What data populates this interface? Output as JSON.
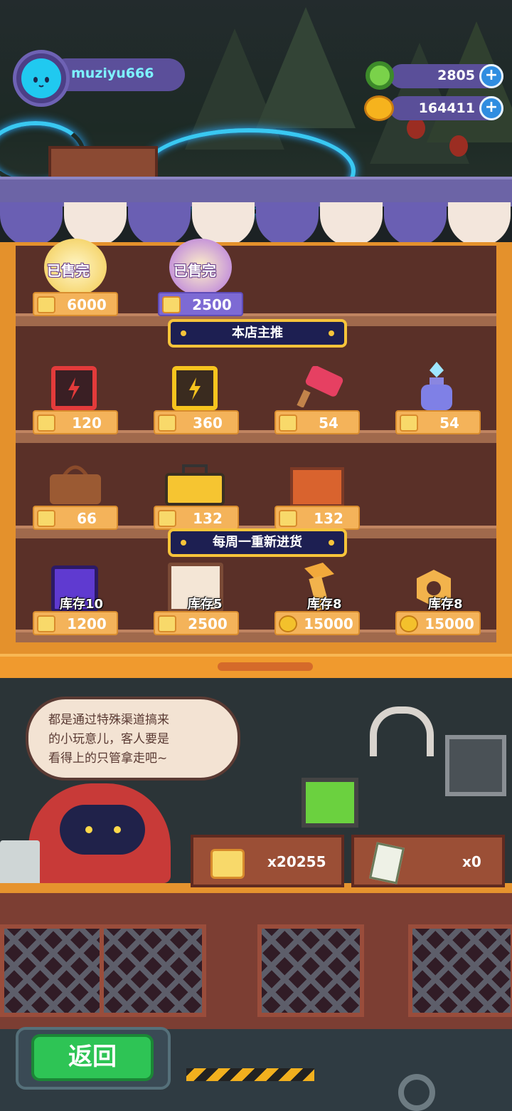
{
  "player": {
    "username": "muziyu666"
  },
  "currency": {
    "gems": "2805",
    "coins": "164411",
    "add_symbol": "+"
  },
  "shop": {
    "sold_out_label": "已售完",
    "featured_banner": "本店主推",
    "weekly_banner": "每周一重新进货",
    "top_row": [
      {
        "name": "cookie-bowl",
        "price": "6000",
        "color": "#f4b35a"
      },
      {
        "name": "grape-bowl",
        "price": "2500",
        "color": "#7d6ad4"
      }
    ],
    "featured_row1": [
      {
        "name": "red-battery",
        "price": "120"
      },
      {
        "name": "yellow-battery",
        "price": "360"
      },
      {
        "name": "paint-hammer",
        "price": "54"
      },
      {
        "name": "blue-potion",
        "price": "54"
      }
    ],
    "featured_row2": [
      {
        "name": "handbag",
        "price": "66"
      },
      {
        "name": "toolbox",
        "price": "132"
      },
      {
        "name": "orange-crate",
        "price": "132"
      }
    ],
    "weekly_row": [
      {
        "name": "purple-card",
        "stock": "库存10",
        "price": "1200",
        "currency": "ticket"
      },
      {
        "name": "photo-card",
        "stock": "库存5",
        "price": "2500",
        "currency": "ticket"
      },
      {
        "name": "golden-bolt",
        "stock": "库存8",
        "price": "15000",
        "currency": "coin"
      },
      {
        "name": "golden-nut",
        "stock": "库存8",
        "price": "15000",
        "currency": "coin"
      }
    ]
  },
  "shopkeeper": {
    "dialogue_line1": "都是通过特殊渠道搞来",
    "dialogue_line2": "的小玩意儿，客人要是",
    "dialogue_line3": "看得上的只管拿走吧~"
  },
  "inventory": {
    "tickets": "x20255",
    "vouchers": "x0"
  },
  "nav": {
    "back_label": "返回"
  }
}
